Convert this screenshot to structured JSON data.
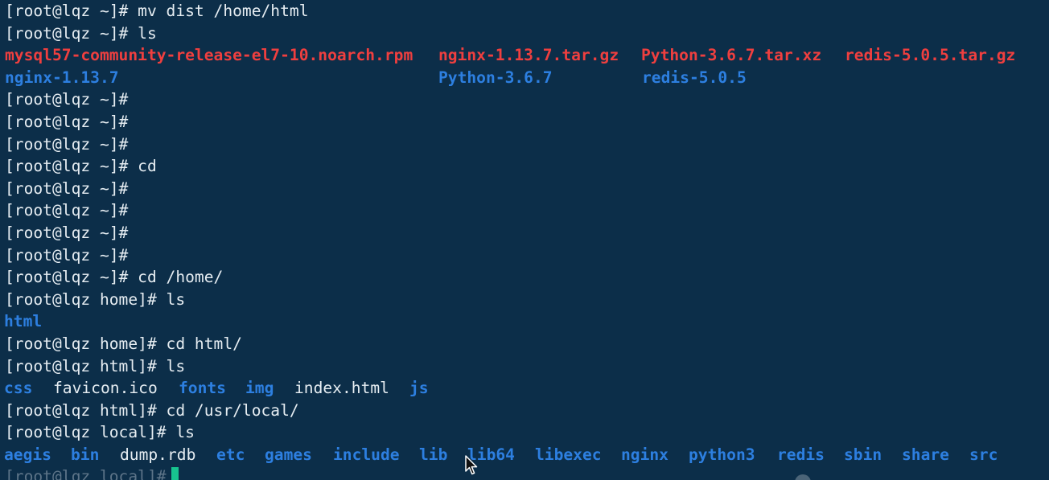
{
  "terminal": {
    "prompt_home_tilde": "[root@lqz ~]#",
    "prompt_home_dir": "[root@lqz home]#",
    "prompt_html_dir": "[root@lqz html]#",
    "prompt_local_dir": "[root@lqz local]#",
    "lines": [
      {
        "prompt": "[root@lqz ~]#",
        "command": " mv dist /home/html"
      },
      {
        "prompt": "[root@lqz ~]#",
        "command": " ls"
      },
      {
        "prompt": "[root@lqz ~]#",
        "command": ""
      },
      {
        "prompt": "[root@lqz ~]#",
        "command": ""
      },
      {
        "prompt": "[root@lqz ~]#",
        "command": ""
      },
      {
        "prompt": "[root@lqz ~]#",
        "command": " cd"
      },
      {
        "prompt": "[root@lqz ~]#",
        "command": ""
      },
      {
        "prompt": "[root@lqz ~]#",
        "command": ""
      },
      {
        "prompt": "[root@lqz ~]#",
        "command": ""
      },
      {
        "prompt": "[root@lqz ~]#",
        "command": ""
      },
      {
        "prompt": "[root@lqz ~]#",
        "command": " cd /home/"
      },
      {
        "prompt": "[root@lqz home]#",
        "command": " ls"
      },
      {
        "prompt": "[root@lqz home]#",
        "command": " cd html/"
      },
      {
        "prompt": "[root@lqz html]#",
        "command": " ls"
      },
      {
        "prompt": "[root@lqz html]#",
        "command": " cd /usr/local/"
      },
      {
        "prompt": "[root@lqz local]#",
        "command": " ls"
      },
      {
        "prompt": "[root@lqz local]#",
        "command": ""
      }
    ],
    "ls_root_row1": [
      {
        "name": "mysql57-community-release-el7-10.noarch.rpm",
        "type": "archive"
      },
      {
        "name": "nginx-1.13.7.tar.gz",
        "type": "archive"
      },
      {
        "name": "Python-3.6.7.tar.xz",
        "type": "archive"
      },
      {
        "name": "redis-5.0.5.tar.gz",
        "type": "archive"
      }
    ],
    "ls_root_row2": [
      {
        "name": "nginx-1.13.7",
        "type": "dir"
      },
      {
        "name": "Python-3.6.7",
        "type": "dir"
      },
      {
        "name": "redis-5.0.5",
        "type": "dir"
      }
    ],
    "ls_home": [
      {
        "name": "html",
        "type": "dir"
      }
    ],
    "ls_html": [
      {
        "name": "css",
        "type": "dir"
      },
      {
        "name": "favicon.ico",
        "type": "file"
      },
      {
        "name": "fonts",
        "type": "dir"
      },
      {
        "name": "img",
        "type": "dir"
      },
      {
        "name": "index.html",
        "type": "file"
      },
      {
        "name": "js",
        "type": "dir"
      }
    ],
    "ls_local": [
      {
        "name": "aegis",
        "type": "dir"
      },
      {
        "name": "bin",
        "type": "dir"
      },
      {
        "name": "dump.rdb",
        "type": "file"
      },
      {
        "name": "etc",
        "type": "dir"
      },
      {
        "name": "games",
        "type": "dir"
      },
      {
        "name": "include",
        "type": "dir"
      },
      {
        "name": "lib",
        "type": "dir"
      },
      {
        "name": "lib64",
        "type": "dir"
      },
      {
        "name": "libexec",
        "type": "dir"
      },
      {
        "name": "nginx",
        "type": "dir"
      },
      {
        "name": "python3",
        "type": "dir"
      },
      {
        "name": "redis",
        "type": "dir"
      },
      {
        "name": "sbin",
        "type": "dir"
      },
      {
        "name": "share",
        "type": "dir"
      },
      {
        "name": "src",
        "type": "dir"
      }
    ]
  },
  "colors": {
    "background": "#0c2e49",
    "text": "#e6edf2",
    "archive": "#ef3f3f",
    "directory": "#2d7fe0",
    "cursor": "#17c48f"
  },
  "icons": {
    "pointer": "mouse-pointer-icon"
  }
}
